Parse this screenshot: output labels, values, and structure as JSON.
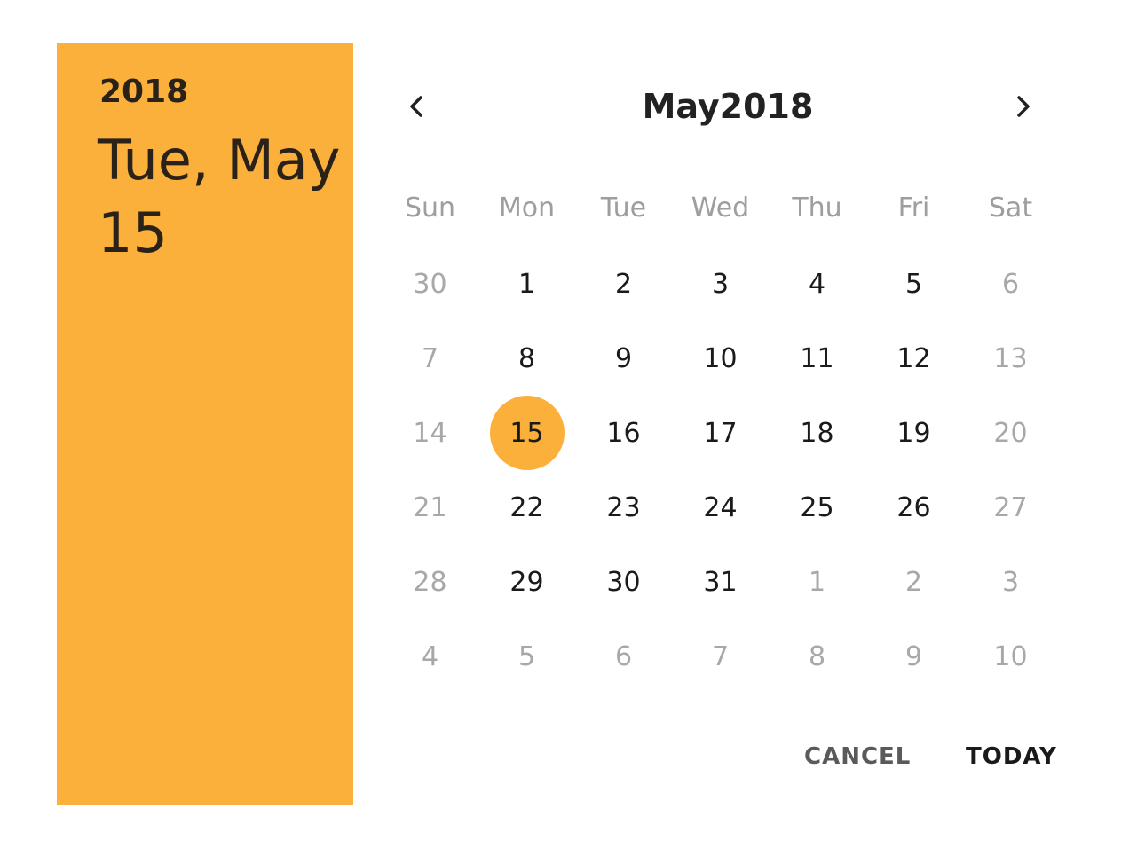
{
  "header": {
    "year": "2018",
    "date": "Tue, May 15",
    "background_color": "#fbb03b"
  },
  "nav": {
    "title": "May2018",
    "prev_icon": "chevron-left-icon",
    "next_icon": "chevron-right-icon"
  },
  "weekdays": [
    "Sun",
    "Mon",
    "Tue",
    "Wed",
    "Thu",
    "Fri",
    "Sat"
  ],
  "weeks": [
    [
      {
        "label": "30",
        "in_month": false
      },
      {
        "label": "1",
        "in_month": true
      },
      {
        "label": "2",
        "in_month": true
      },
      {
        "label": "3",
        "in_month": true
      },
      {
        "label": "4",
        "in_month": true
      },
      {
        "label": "5",
        "in_month": true
      },
      {
        "label": "6",
        "in_month": false
      }
    ],
    [
      {
        "label": "7",
        "in_month": false
      },
      {
        "label": "8",
        "in_month": true
      },
      {
        "label": "9",
        "in_month": true
      },
      {
        "label": "10",
        "in_month": true
      },
      {
        "label": "11",
        "in_month": true
      },
      {
        "label": "12",
        "in_month": true
      },
      {
        "label": "13",
        "in_month": false
      }
    ],
    [
      {
        "label": "14",
        "in_month": false
      },
      {
        "label": "15",
        "in_month": true,
        "selected": true
      },
      {
        "label": "16",
        "in_month": true
      },
      {
        "label": "17",
        "in_month": true
      },
      {
        "label": "18",
        "in_month": true
      },
      {
        "label": "19",
        "in_month": true
      },
      {
        "label": "20",
        "in_month": false
      }
    ],
    [
      {
        "label": "21",
        "in_month": false
      },
      {
        "label": "22",
        "in_month": true
      },
      {
        "label": "23",
        "in_month": true
      },
      {
        "label": "24",
        "in_month": true
      },
      {
        "label": "25",
        "in_month": true
      },
      {
        "label": "26",
        "in_month": true
      },
      {
        "label": "27",
        "in_month": false
      }
    ],
    [
      {
        "label": "28",
        "in_month": false
      },
      {
        "label": "29",
        "in_month": true
      },
      {
        "label": "30",
        "in_month": true
      },
      {
        "label": "31",
        "in_month": true
      },
      {
        "label": "1",
        "in_month": false
      },
      {
        "label": "2",
        "in_month": false
      },
      {
        "label": "3",
        "in_month": false
      }
    ],
    [
      {
        "label": "4",
        "in_month": false
      },
      {
        "label": "5",
        "in_month": false
      },
      {
        "label": "6",
        "in_month": false
      },
      {
        "label": "7",
        "in_month": false
      },
      {
        "label": "8",
        "in_month": false
      },
      {
        "label": "9",
        "in_month": false
      },
      {
        "label": "10",
        "in_month": false
      }
    ]
  ],
  "actions": {
    "cancel_label": "CANCEL",
    "today_label": "TODAY"
  },
  "colors": {
    "accent": "#fbb03b",
    "text_primary": "#1a1a1a",
    "text_muted": "#a8a8a8"
  }
}
